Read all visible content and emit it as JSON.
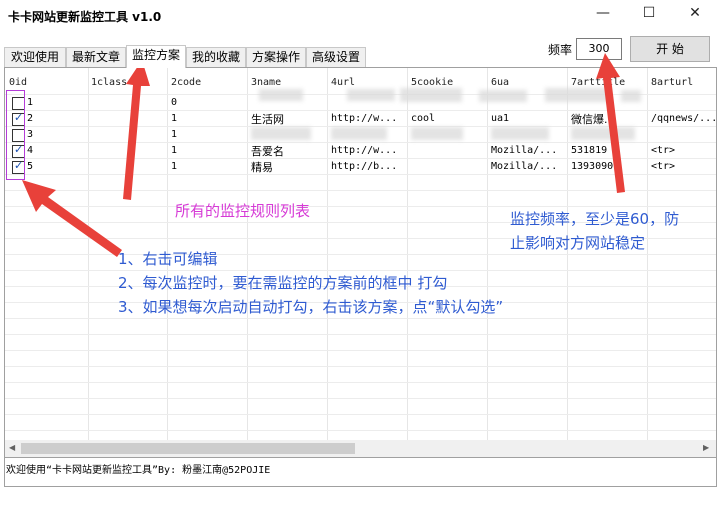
{
  "window": {
    "title": "卡卡网站更新监控工具 v1.0",
    "minimize_icon": "minimize-icon",
    "maximize_icon": "maximize-icon",
    "close_icon": "close-icon"
  },
  "tabs": [
    {
      "label": "欢迎使用"
    },
    {
      "label": "最新文章"
    },
    {
      "label": "监控方案",
      "active": true
    },
    {
      "label": "我的收藏"
    },
    {
      "label": "方案操作"
    },
    {
      "label": "高级设置"
    }
  ],
  "toolbar": {
    "frequency_label": "频率",
    "frequency_value": "300",
    "start_label": "开 始"
  },
  "table": {
    "columns": [
      "0id",
      "1class",
      "2code",
      "3name",
      "4url",
      "5cookie",
      "6ua",
      "7arttitle",
      "8arturl"
    ],
    "rows": [
      {
        "checked": false,
        "id": "1",
        "class": "",
        "code": "0",
        "name": "",
        "url": "",
        "cookie": "",
        "ua": "",
        "arttitle": "",
        "arturl": ""
      },
      {
        "checked": true,
        "id": "2",
        "class": "",
        "code": "1",
        "name": "生活网",
        "url": "http://w...",
        "cookie": "cool",
        "ua": "ua1",
        "arttitle": "微信爆...",
        "arturl": "/qqnews/..."
      },
      {
        "checked": false,
        "id": "3",
        "class": "",
        "code": "1",
        "name": "",
        "url": "",
        "cookie": "",
        "ua": "",
        "arttitle": "",
        "arturl": ""
      },
      {
        "checked": true,
        "id": "4",
        "class": "",
        "code": "1",
        "name": "吾爱名",
        "url": "http://w...",
        "cookie": "",
        "ua": "Mozilla/...",
        "arttitle": "531819",
        "arturl": "<tr>"
      },
      {
        "checked": true,
        "id": "5",
        "class": "",
        "code": "1",
        "name": "精易",
        "url": "http://b...",
        "cookie": "",
        "ua": "Mozilla/...",
        "arttitle": "13930907",
        "arturl": "<tr>"
      }
    ]
  },
  "annotations": {
    "rules_list": "所有的监控规则列表",
    "freq_note_1": "监控频率，至少是60，防",
    "freq_note_2": "止影响对方网站稳定",
    "tip_1": "1、右击可编辑",
    "tip_2": "2、每次监控时，要在需监控的方案前的框中 打勾",
    "tip_3": "3、如果想每次启动自动打勾，右击该方案，点“默认勾选”"
  },
  "status": {
    "text": "欢迎使用“卡卡网站更新监控工具”By: 粉墨江南@52POJIE"
  },
  "colors": {
    "pink_note": "#d63ad6",
    "blue_note": "#2f5bd1",
    "arrow_red": "#e8413a"
  }
}
